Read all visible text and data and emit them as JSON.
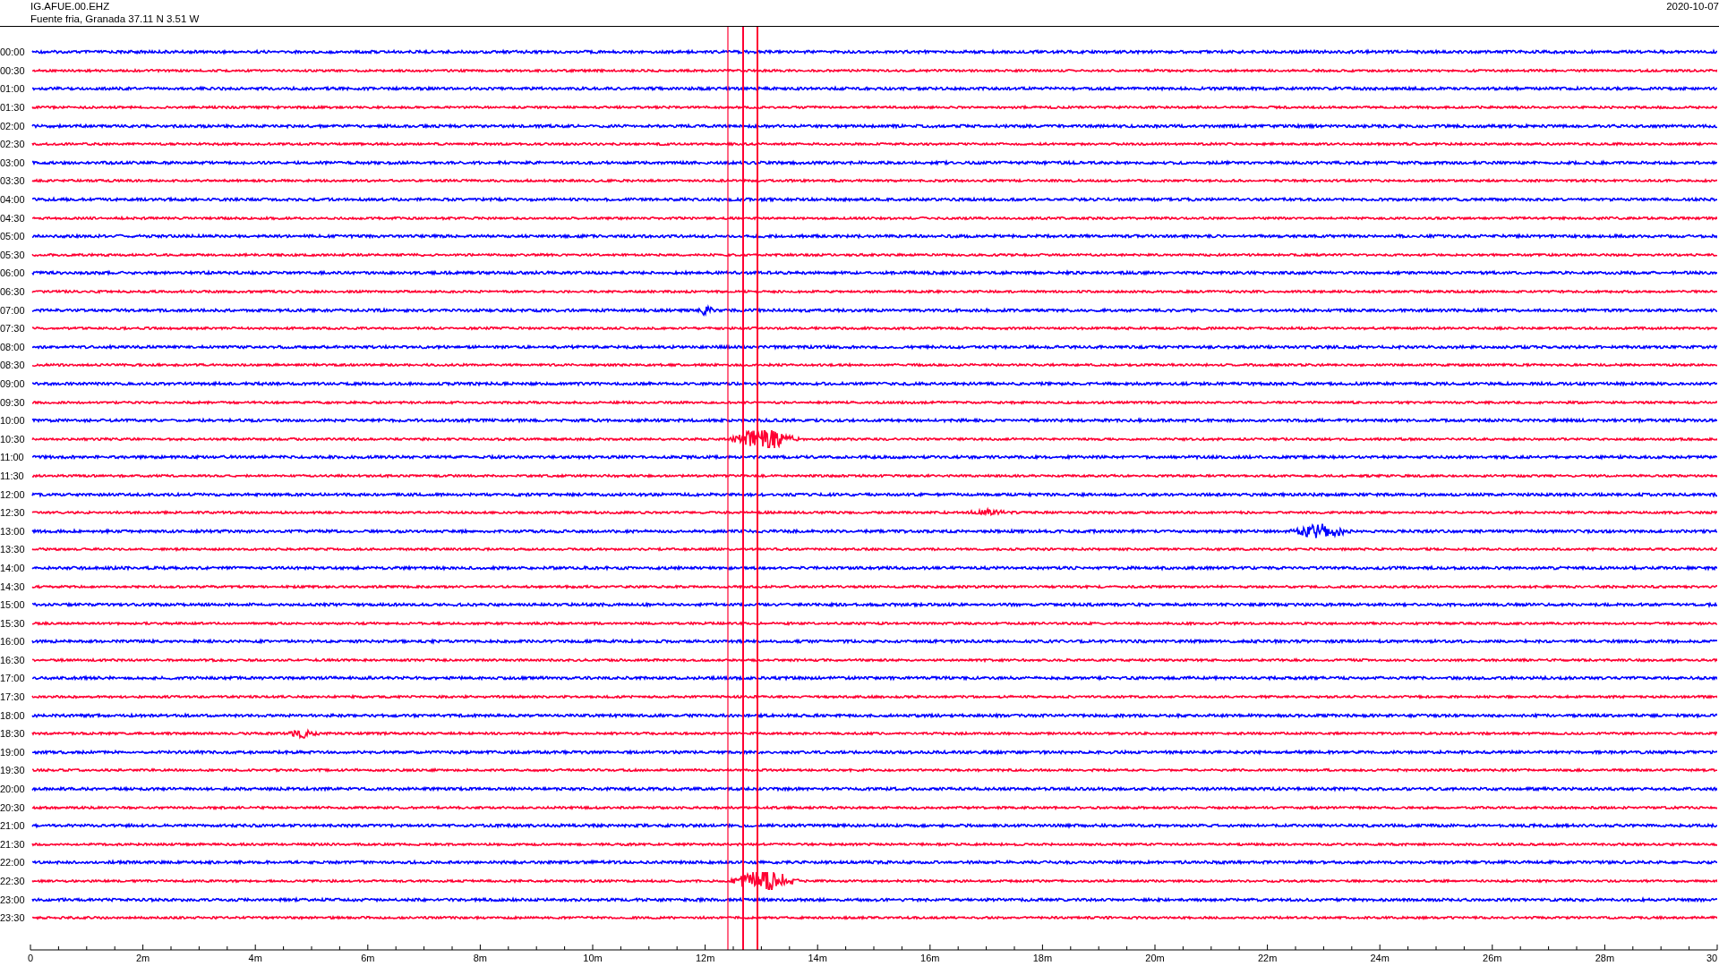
{
  "header": {
    "station": "IG.AFUE.00.EHZ",
    "location": "Fuente fria, Granada  37.11 N 3.51 W",
    "date": "2020-10-07"
  },
  "rows": [
    {
      "time": "00:00",
      "color": "#0000ff"
    },
    {
      "time": "00:30",
      "color": "#ff0033"
    },
    {
      "time": "01:00",
      "color": "#0000ff"
    },
    {
      "time": "01:30",
      "color": "#ff0033"
    },
    {
      "time": "02:00",
      "color": "#0000ff"
    },
    {
      "time": "02:30",
      "color": "#ff0033"
    },
    {
      "time": "03:00",
      "color": "#0000ff"
    },
    {
      "time": "03:30",
      "color": "#ff0033"
    },
    {
      "time": "04:00",
      "color": "#0000ff"
    },
    {
      "time": "04:30",
      "color": "#ff0033"
    },
    {
      "time": "05:00",
      "color": "#0000ff"
    },
    {
      "time": "05:30",
      "color": "#ff0033"
    },
    {
      "time": "06:00",
      "color": "#0000ff"
    },
    {
      "time": "06:30",
      "color": "#ff0033"
    },
    {
      "time": "07:00",
      "color": "#0000ff"
    },
    {
      "time": "07:30",
      "color": "#ff0033"
    },
    {
      "time": "08:00",
      "color": "#0000ff"
    },
    {
      "time": "08:30",
      "color": "#ff0033"
    },
    {
      "time": "09:00",
      "color": "#0000ff"
    },
    {
      "time": "09:30",
      "color": "#ff0033"
    },
    {
      "time": "10:00",
      "color": "#0000ff"
    },
    {
      "time": "10:30",
      "color": "#ff0033"
    },
    {
      "time": "11:00",
      "color": "#0000ff"
    },
    {
      "time": "11:30",
      "color": "#ff0033"
    },
    {
      "time": "12:00",
      "color": "#0000ff"
    },
    {
      "time": "12:30",
      "color": "#ff0033"
    },
    {
      "time": "13:00",
      "color": "#0000ff"
    },
    {
      "time": "13:30",
      "color": "#ff0033"
    },
    {
      "time": "14:00",
      "color": "#0000ff"
    },
    {
      "time": "14:30",
      "color": "#ff0033"
    },
    {
      "time": "15:00",
      "color": "#0000ff"
    },
    {
      "time": "15:30",
      "color": "#ff0033"
    },
    {
      "time": "16:00",
      "color": "#0000ff"
    },
    {
      "time": "16:30",
      "color": "#ff0033"
    },
    {
      "time": "17:00",
      "color": "#0000ff"
    },
    {
      "time": "17:30",
      "color": "#ff0033"
    },
    {
      "time": "18:00",
      "color": "#0000ff"
    },
    {
      "time": "18:30",
      "color": "#ff0033"
    },
    {
      "time": "19:00",
      "color": "#0000ff"
    },
    {
      "time": "19:30",
      "color": "#ff0033"
    },
    {
      "time": "20:00",
      "color": "#0000ff"
    },
    {
      "time": "20:30",
      "color": "#ff0033"
    },
    {
      "time": "21:00",
      "color": "#0000ff"
    },
    {
      "time": "21:30",
      "color": "#ff0033"
    },
    {
      "time": "22:00",
      "color": "#0000ff"
    },
    {
      "time": "22:30",
      "color": "#ff0033"
    },
    {
      "time": "23:00",
      "color": "#0000ff"
    },
    {
      "time": "23:30",
      "color": "#ff0033"
    }
  ],
  "x_axis": {
    "labels": [
      "0",
      "2m",
      "4m",
      "6m",
      "8m",
      "10m",
      "12m",
      "14m",
      "16m",
      "18m",
      "20m",
      "22m",
      "24m",
      "26m",
      "28m",
      "30"
    ]
  }
}
